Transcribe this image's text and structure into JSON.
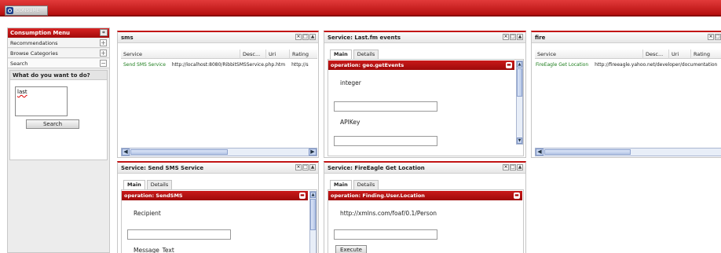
{
  "app": {
    "logo_text": "CONSUME"
  },
  "sidebar": {
    "title": "Consumption Menu",
    "items": [
      {
        "label": "Recommendations",
        "sign": "+"
      },
      {
        "label": "Browse Categories",
        "sign": "+"
      },
      {
        "label": "Search",
        "sign": "−"
      }
    ],
    "search_box": {
      "title": "What do you want to do?",
      "query": "last",
      "button": "Search"
    }
  },
  "panels": {
    "sms": {
      "title": "sms",
      "columns": [
        "Service",
        "Desc...",
        "Uri",
        "Rating"
      ],
      "rows": [
        {
          "service": "Send SMS Service",
          "desc": "http://localhost:8080/RibbitSMSService.php.htm",
          "uri": "http://s"
        }
      ]
    },
    "lastfm": {
      "title": "Service: Last.fm events",
      "tabs": [
        "Main",
        "Details"
      ],
      "operation": "operation: geo.getEvents",
      "params": [
        "integer",
        "APIKey"
      ]
    },
    "fire": {
      "title": "fire",
      "columns": [
        "Service",
        "Desc...",
        "Uri",
        "Rating"
      ],
      "rows": [
        {
          "service": "FireEagle Get Location",
          "desc": "http://fireeagle.yahoo.net/developer/documentation"
        }
      ]
    },
    "sendsms": {
      "title": "Service: Send SMS Service",
      "tabs": [
        "Main",
        "Details"
      ],
      "operation": "operation: SendSMS",
      "params": [
        "Recipient",
        "Message_Text"
      ]
    },
    "fireeagle": {
      "title": "Service: FireEagle Get Location",
      "tabs": [
        "Main",
        "Details"
      ],
      "operation": "operation: Finding.User.Location",
      "params": [
        "http://xmlns.com/foaf/0.1/Person"
      ],
      "execute": "Execute"
    }
  },
  "icons": {
    "close": "×",
    "maximize": "□",
    "collapse": "▲",
    "scroll_left": "◀",
    "scroll_right": "▶",
    "scroll_up": "▲",
    "scroll_down": "▼",
    "op_collapse": "▬"
  }
}
